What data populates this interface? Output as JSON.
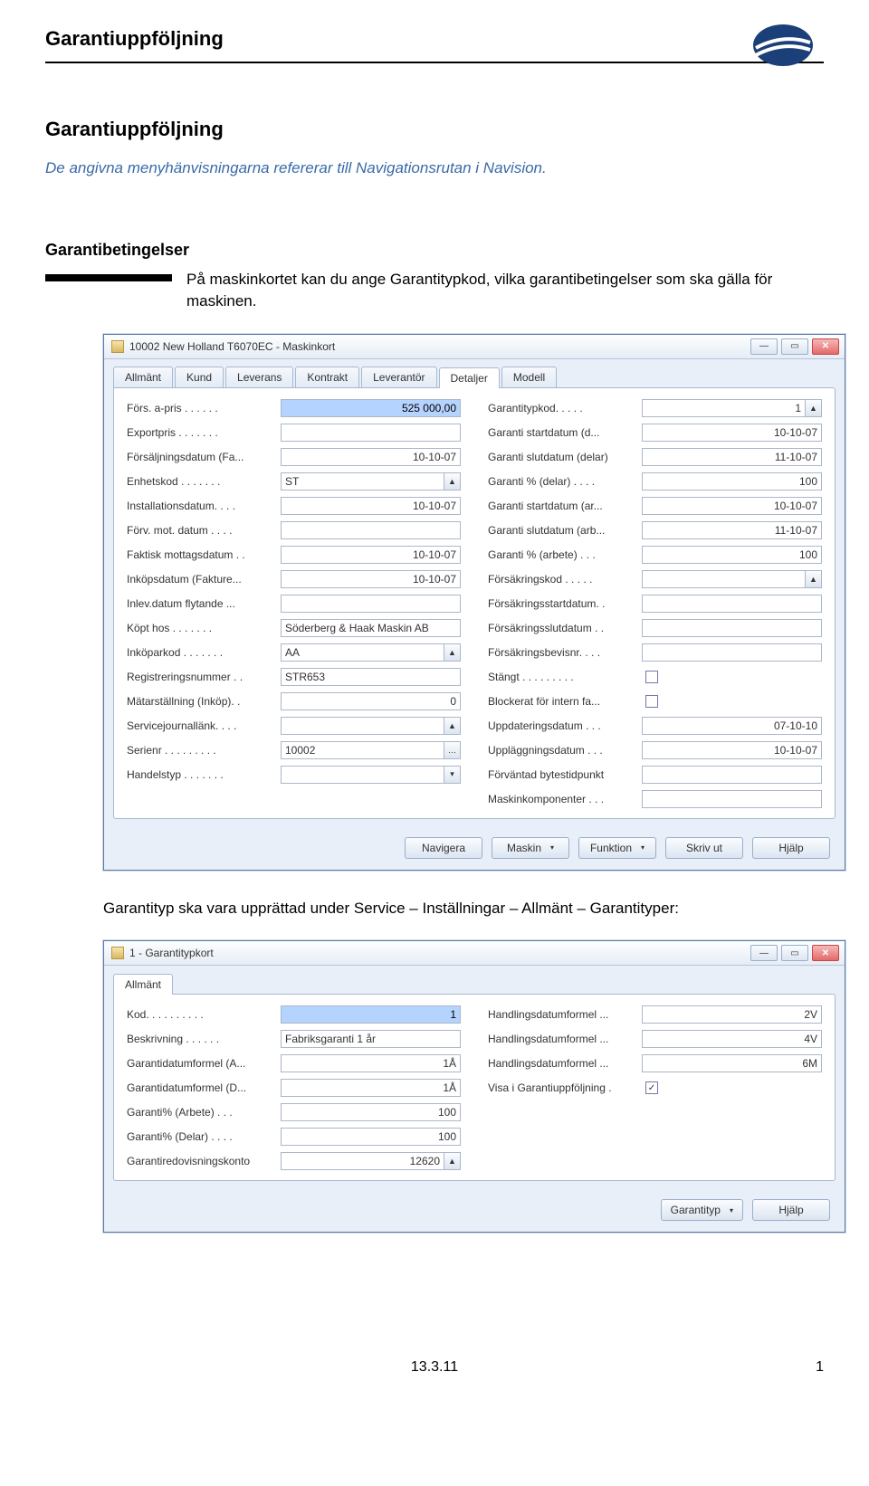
{
  "header": {
    "title": "Garantiuppföljning"
  },
  "doc": {
    "title": "Garantiuppföljning",
    "intro": "De angivna menyhänvisningarna refererar till Navigationsrutan i Navision."
  },
  "section1": {
    "heading": "Garantibetingelser",
    "text": "På maskinkortet kan du ange Garantitypkod, vilka garantibetingelser som ska gälla för maskinen."
  },
  "win1": {
    "title": "10002 New Holland T6070EC - Maskinkort",
    "tabs": [
      "Allmänt",
      "Kund",
      "Leverans",
      "Kontrakt",
      "Leverantör",
      "Detaljer",
      "Modell"
    ],
    "active_tab": 5,
    "left": [
      {
        "l": "Förs. a-pris . . . . . .",
        "v": "525 000,00",
        "sel": true,
        "a": null
      },
      {
        "l": "Exportpris . . . . . . .",
        "v": "",
        "a": null
      },
      {
        "l": "Försäljningsdatum (Fa...",
        "v": "10-10-07",
        "a": null
      },
      {
        "l": "Enhetskod . . . . . . .",
        "v": "ST",
        "left": true,
        "a": "▲"
      },
      {
        "l": "Installationsdatum. . . .",
        "v": "10-10-07",
        "a": null
      },
      {
        "l": "Förv. mot. datum . . . .",
        "v": "",
        "a": null
      },
      {
        "l": "Faktisk mottagsdatum . .",
        "v": "10-10-07",
        "a": null
      },
      {
        "l": "Inköpsdatum (Fakture...",
        "v": "10-10-07",
        "a": null
      },
      {
        "l": "Inlev.datum flytande ...",
        "v": "",
        "a": null
      },
      {
        "l": "Köpt hos . . . . . . .",
        "v": "Söderberg & Haak Maskin AB",
        "left": true,
        "a": null
      },
      {
        "l": "Inköparkod . . . . . . .",
        "v": "AA",
        "left": true,
        "a": "▲"
      },
      {
        "l": "Registreringsnummer . .",
        "v": "STR653",
        "left": true,
        "a": null
      },
      {
        "l": "Mätarställning (Inköp). .",
        "v": "0",
        "a": null
      },
      {
        "l": "Servicejournallänk. . . .",
        "v": "",
        "a": "▲"
      },
      {
        "l": "Serienr . . . . . . . . .",
        "v": "10002",
        "left": true,
        "a": "…"
      },
      {
        "l": "Handelstyp . . . . . . .",
        "v": "",
        "a": "▾"
      }
    ],
    "right": [
      {
        "l": "Garantitypkod. . . . .",
        "v": "1",
        "a": "▲"
      },
      {
        "l": "Garanti startdatum (d...",
        "v": "10-10-07",
        "a": null
      },
      {
        "l": "Garanti slutdatum (delar)",
        "v": "11-10-07",
        "a": null
      },
      {
        "l": "Garanti % (delar) . . . .",
        "v": "100",
        "a": null
      },
      {
        "l": "Garanti startdatum (ar...",
        "v": "10-10-07",
        "a": null
      },
      {
        "l": "Garanti slutdatum (arb...",
        "v": "11-10-07",
        "a": null
      },
      {
        "l": "Garanti % (arbete) . . .",
        "v": "100",
        "a": null
      },
      {
        "l": "Försäkringskod . . . . .",
        "v": "",
        "a": "▲"
      },
      {
        "l": "Försäkringsstartdatum. .",
        "v": "",
        "a": null
      },
      {
        "l": "Försäkringsslutdatum . .",
        "v": "",
        "a": null
      },
      {
        "l": "Försäkringsbevisnr. . . .",
        "v": "",
        "a": null
      },
      {
        "l": "Stängt . . . . . . . . .",
        "chk": false
      },
      {
        "l": "Blockerat för intern fa...",
        "chk": false
      },
      {
        "l": "Uppdateringsdatum . . .",
        "v": "07-10-10",
        "a": null
      },
      {
        "l": "Uppläggningsdatum . . .",
        "v": "10-10-07",
        "a": null
      },
      {
        "l": "Förväntad bytestidpunkt",
        "v": "",
        "a": null
      },
      {
        "l": "Maskinkomponenter . . .",
        "v": "",
        "a": null
      }
    ],
    "buttons": [
      "Navigera",
      "Maskin",
      "Funktion",
      "Skriv ut",
      "Hjälp"
    ],
    "dropdown_buttons": [
      1,
      2
    ]
  },
  "para2": "Garantityp ska vara upprättad under Service – Inställningar – Allmänt – Garantityper:",
  "win2": {
    "title": "1 - Garantitypkort",
    "tabs": [
      "Allmänt"
    ],
    "active_tab": 0,
    "left": [
      {
        "l": "Kod. . . . . . . . . .",
        "v": "1",
        "sel": true,
        "left": true,
        "a": null
      },
      {
        "l": "Beskrivning . . . . . .",
        "v": "Fabriksgaranti 1 år",
        "left": true,
        "a": null
      },
      {
        "l": "Garantidatumformel (A...",
        "v": "1Å",
        "a": null
      },
      {
        "l": "Garantidatumformel (D...",
        "v": "1Å",
        "a": null
      },
      {
        "l": "Garanti% (Arbete) . . .",
        "v": "100",
        "a": null
      },
      {
        "l": "Garanti% (Delar) . . . .",
        "v": "100",
        "a": null
      },
      {
        "l": "Garantiredovisningskonto",
        "v": "12620",
        "a": "▲"
      }
    ],
    "right": [
      {
        "l": "Handlingsdatumformel ...",
        "v": "2V",
        "a": null
      },
      {
        "l": "Handlingsdatumformel ...",
        "v": "4V",
        "a": null
      },
      {
        "l": "Handlingsdatumformel ...",
        "v": "6M",
        "a": null
      },
      {
        "l": "Visa i Garantiuppföljning .",
        "chk": true
      }
    ],
    "buttons": [
      "Garantityp",
      "Hjälp"
    ],
    "dropdown_buttons": [
      0
    ]
  },
  "footer": {
    "center": "13.3.11",
    "page": "1"
  }
}
